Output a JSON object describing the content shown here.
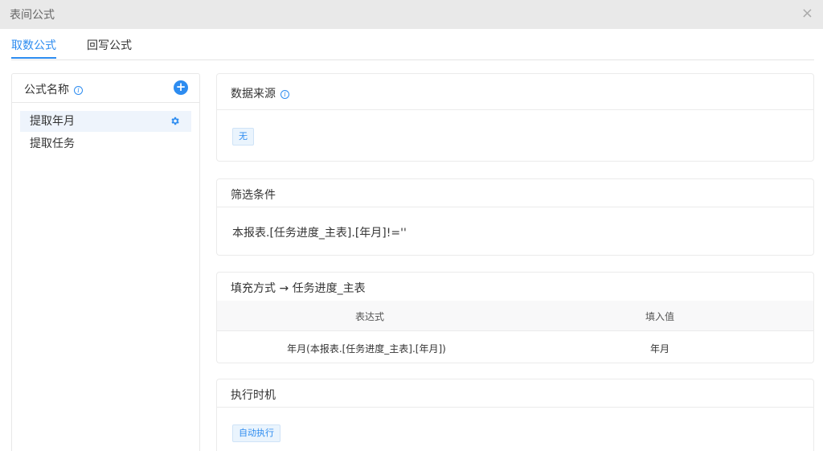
{
  "window": {
    "title": "表间公式",
    "close_glyph": "×"
  },
  "tabs": [
    {
      "label": "取数公式",
      "active": true
    },
    {
      "label": "回写公式",
      "active": false
    }
  ],
  "formula_list": {
    "header": "公式名称",
    "add_glyph": "+",
    "items": [
      {
        "label": "提取年月",
        "selected": true
      },
      {
        "label": "提取任务",
        "selected": false
      }
    ]
  },
  "data_source": {
    "title": "数据来源",
    "value": "无"
  },
  "filter": {
    "title": "筛选条件",
    "expression": "本报表.[任务进度_主表].[年月]!=''"
  },
  "fill": {
    "title": "填充方式 → 任务进度_主表",
    "columns": [
      "表达式",
      "填入值"
    ],
    "rows": [
      [
        "年月(本报表.[任务进度_主表].[年月])",
        "年月"
      ]
    ]
  },
  "timing": {
    "title": "执行时机",
    "value": "自动执行"
  },
  "colors": {
    "accent": "#2d8cf0",
    "titlebar_bg": "#e9e9e9",
    "selected_bg": "#eef4fc",
    "table_head_bg": "#f8f8f9"
  }
}
